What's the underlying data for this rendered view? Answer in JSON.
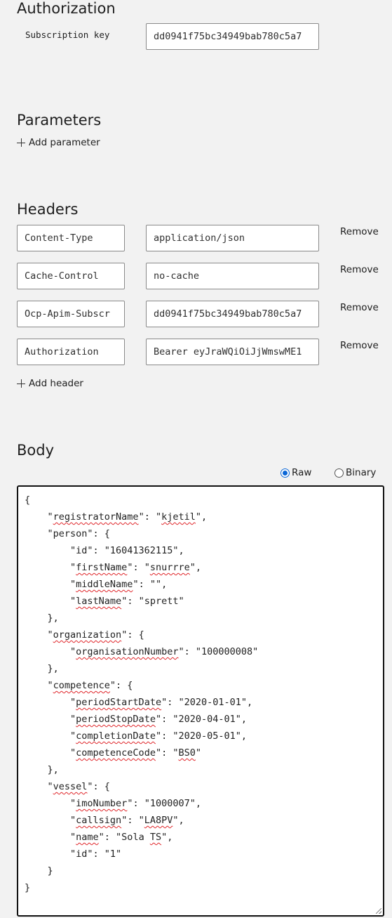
{
  "authorization": {
    "title": "Authorization",
    "subscription_key_label": "Subscription key",
    "subscription_key_value": "dd0941f75bc34949bab780c5a7"
  },
  "parameters": {
    "title": "Parameters",
    "add_label": "Add parameter"
  },
  "headers": {
    "title": "Headers",
    "remove_label": "Remove",
    "add_label": "Add header",
    "rows": [
      {
        "key": "Content-Type",
        "value": "application/json"
      },
      {
        "key": "Cache-Control",
        "value": "no-cache"
      },
      {
        "key": "Ocp-Apim-Subscr",
        "value": "dd0941f75bc34949bab780c5a7"
      },
      {
        "key": "Authorization",
        "value": "Bearer eyJraWQiOiJjWmswME1"
      }
    ]
  },
  "body": {
    "title": "Body",
    "raw_label": "Raw",
    "binary_label": "Binary",
    "selected_format": "Raw",
    "code_lines": [
      "{",
      "    \"registratorName\": \"kjetil\",",
      "    \"person\": {",
      "        \"id\": \"16041362115\",",
      "        \"firstName\": \"snurrre\",",
      "        \"middleName\": \"\",",
      "        \"lastName\": \"sprett\"",
      "    },",
      "    \"organization\": {",
      "        \"organisationNumber\": \"100000008\"",
      "    },",
      "    \"competence\": {",
      "        \"periodStartDate\": \"2020-01-01\",",
      "        \"periodStopDate\": \"2020-04-01\",",
      "        \"completionDate\": \"2020-05-01\",",
      "        \"competenceCode\": \"BS0\"",
      "    },",
      "    \"vessel\": {",
      "        \"imoNumber\": \"1000007\",",
      "        \"callsign\": \"LA8PV\",",
      "        \"name\": \"Sola TS\",",
      "        \"id\": \"1\"",
      "    }",
      "}"
    ],
    "spellcheck_words": [
      "registratorName",
      "kjetil",
      "firstName",
      "snurrre",
      "middleName",
      "lastName",
      "organization",
      "organisationNumber",
      "competence",
      "periodStartDate",
      "periodStopDate",
      "completionDate",
      "competenceCode",
      "BS0",
      "vessel",
      "imoNumber",
      "callsign",
      "LA8PV",
      "name",
      "TS"
    ]
  },
  "colors": {
    "accent": "#0a66d6",
    "spellcheck": "#e0262a",
    "page_background": "#f2f2f2"
  }
}
